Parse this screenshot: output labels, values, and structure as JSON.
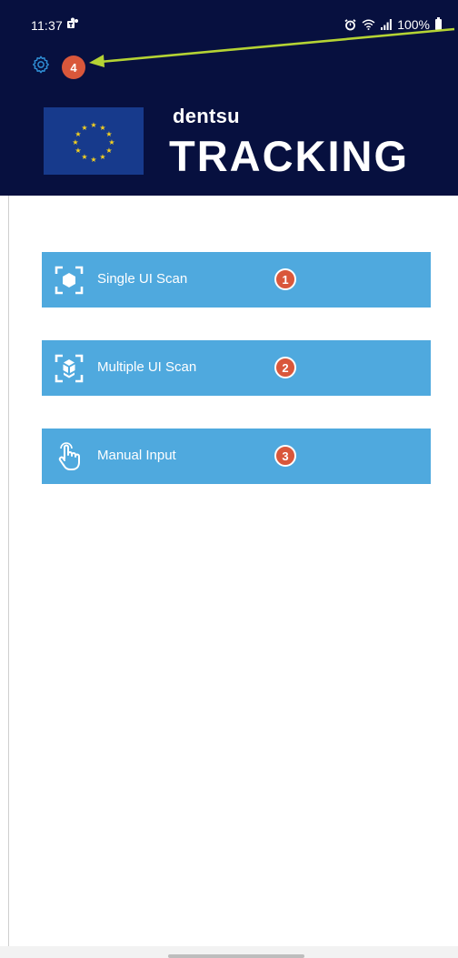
{
  "status_bar": {
    "time": "11:37",
    "battery": "100%",
    "icons": [
      "teams-icon",
      "alarm-icon",
      "wifi-icon",
      "signal-icon",
      "battery-icon"
    ]
  },
  "header": {
    "settings_icon": "gear-icon",
    "settings_badge": "4",
    "brand_small": "dentsu",
    "brand_large": "TRACKING",
    "logo": "eu-flag-icon",
    "colors": {
      "background": "#07103f",
      "badge": "#d9573b",
      "arrow": "#b5d334"
    }
  },
  "actions": [
    {
      "label": "Single UI Scan",
      "icon": "scan-single-icon",
      "badge": "1"
    },
    {
      "label": "Multiple UI Scan",
      "icon": "scan-multiple-icon",
      "badge": "2"
    },
    {
      "label": "Manual Input",
      "icon": "hand-pointer-icon",
      "badge": "3"
    }
  ],
  "colors": {
    "button": "#4fa9de"
  }
}
